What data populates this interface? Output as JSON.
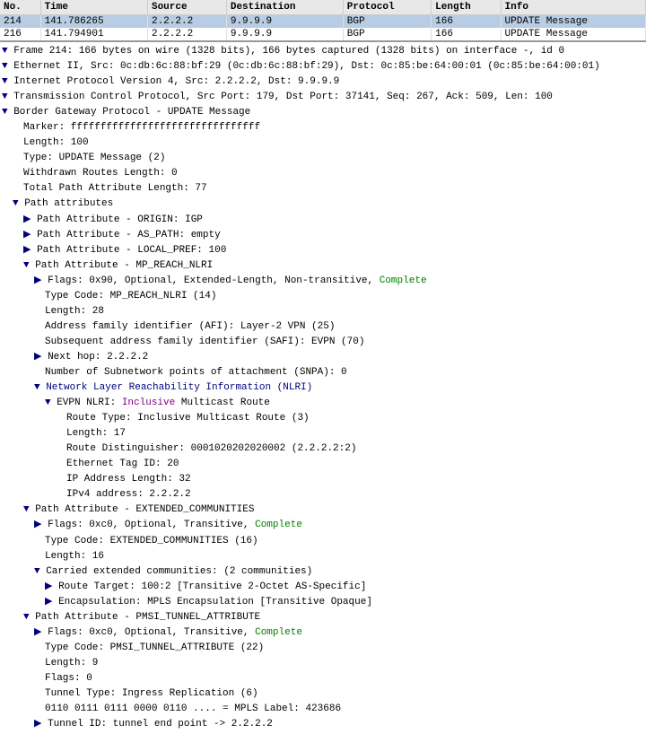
{
  "table": {
    "headers": [
      "No.",
      "Time",
      "Source",
      "Destination",
      "Protocol",
      "Length",
      "Info"
    ],
    "rows": [
      {
        "no": "214",
        "time": "141.786265",
        "source": "2.2.2.2",
        "destination": "9.9.9.9",
        "protocol": "BGP",
        "length": "166",
        "info": "UPDATE Message",
        "selected": true
      },
      {
        "no": "216",
        "time": "141.794901",
        "source": "2.2.2.2",
        "destination": "9.9.9.9",
        "protocol": "BGP",
        "length": "166",
        "info": "UPDATE Message",
        "selected": false
      }
    ]
  },
  "detail": {
    "lines": [
      {
        "indent": 0,
        "type": "arrow-down",
        "text": "Frame 214: 166 bytes on wire (1328 bits), 166 bytes captured (1328 bits) on interface -, id 0"
      },
      {
        "indent": 0,
        "type": "arrow-down",
        "text": "Ethernet II, Src: 0c:db:6c:88:bf:29 (0c:db:6c:88:bf:29), Dst: 0c:85:be:64:00:01 (0c:85:be:64:00:01)"
      },
      {
        "indent": 0,
        "type": "arrow-down",
        "text": "Internet Protocol Version 4, Src: 2.2.2.2, Dst: 9.9.9.9"
      },
      {
        "indent": 0,
        "type": "arrow-down",
        "text": "Transmission Control Protocol, Src Port: 179, Dst Port: 37141, Seq: 267, Ack: 509, Len: 100"
      },
      {
        "indent": 0,
        "type": "arrow-down",
        "text": "Border Gateway Protocol - UPDATE Message"
      },
      {
        "indent": 1,
        "type": "bullet",
        "text": "Marker: ffffffffffffffffffffffffffffffff"
      },
      {
        "indent": 1,
        "type": "bullet",
        "text": "Length: 100"
      },
      {
        "indent": 1,
        "type": "bullet",
        "text": "Type: UPDATE Message (2)"
      },
      {
        "indent": 1,
        "type": "bullet",
        "text": "Withdrawn Routes Length: 0"
      },
      {
        "indent": 1,
        "type": "bullet",
        "text": "Total Path Attribute Length: 77"
      },
      {
        "indent": 1,
        "type": "arrow-down",
        "text": "Path attributes"
      },
      {
        "indent": 2,
        "type": "arrow-right",
        "text": "Path Attribute - ORIGIN: IGP"
      },
      {
        "indent": 2,
        "type": "arrow-right",
        "text": "Path Attribute - AS_PATH: empty"
      },
      {
        "indent": 2,
        "type": "arrow-right",
        "text": "Path Attribute - LOCAL_PREF: 100"
      },
      {
        "indent": 2,
        "type": "arrow-down",
        "text": "Path Attribute - MP_REACH_NLRI"
      },
      {
        "indent": 3,
        "type": "arrow-right",
        "text": "Flags: 0x90, Optional, Extended-Length, Non-transitive, Complete",
        "highlight": "complete"
      },
      {
        "indent": 3,
        "type": "bullet",
        "text": "Type Code: MP_REACH_NLRI (14)"
      },
      {
        "indent": 3,
        "type": "bullet",
        "text": "Length: 28"
      },
      {
        "indent": 3,
        "type": "bullet",
        "text": "Address family identifier (AFI): Layer-2 VPN (25)"
      },
      {
        "indent": 3,
        "type": "bullet",
        "text": "Subsequent address family identifier (SAFI): EVPN (70)"
      },
      {
        "indent": 3,
        "type": "arrow-right",
        "text": "Next hop: 2.2.2.2"
      },
      {
        "indent": 3,
        "type": "bullet",
        "text": "Number of Subnetwork points of attachment (SNPA): 0"
      },
      {
        "indent": 3,
        "type": "arrow-down",
        "text": "Network Layer Reachability Information (NLRI)",
        "highlight": "network"
      },
      {
        "indent": 4,
        "type": "arrow-down",
        "text": "EVPN NLRI: Inclusive Multicast Route",
        "highlight": "inclusive"
      },
      {
        "indent": 5,
        "type": "bullet",
        "text": "Route Type: Inclusive Multicast Route (3)"
      },
      {
        "indent": 5,
        "type": "bullet",
        "text": "Length: 17"
      },
      {
        "indent": 5,
        "type": "bullet",
        "text": "Route Distinguisher: 0001020202020002 (2.2.2.2:2)"
      },
      {
        "indent": 5,
        "type": "bullet",
        "text": "Ethernet Tag ID: 20"
      },
      {
        "indent": 5,
        "type": "bullet",
        "text": "IP Address Length: 32"
      },
      {
        "indent": 5,
        "type": "bullet",
        "text": "IPv4 address: 2.2.2.2"
      },
      {
        "indent": 2,
        "type": "arrow-down",
        "text": "Path Attribute - EXTENDED_COMMUNITIES"
      },
      {
        "indent": 3,
        "type": "arrow-right",
        "text": "Flags: 0xc0, Optional, Transitive, Complete",
        "highlight": "complete"
      },
      {
        "indent": 3,
        "type": "bullet",
        "text": "Type Code: EXTENDED_COMMUNITIES (16)"
      },
      {
        "indent": 3,
        "type": "bullet",
        "text": "Length: 16"
      },
      {
        "indent": 3,
        "type": "arrow-down",
        "text": "Carried extended communities: (2 communities)"
      },
      {
        "indent": 4,
        "type": "arrow-right",
        "text": "Route Target: 100:2 [Transitive 2-Octet AS-Specific]"
      },
      {
        "indent": 4,
        "type": "arrow-right",
        "text": "Encapsulation: MPLS Encapsulation [Transitive Opaque]"
      },
      {
        "indent": 2,
        "type": "arrow-down",
        "text": "Path Attribute - PMSI_TUNNEL_ATTRIBUTE"
      },
      {
        "indent": 3,
        "type": "arrow-right",
        "text": "Flags: 0xc0, Optional, Transitive, Complete",
        "highlight": "complete"
      },
      {
        "indent": 3,
        "type": "bullet",
        "text": "Type Code: PMSI_TUNNEL_ATTRIBUTE (22)"
      },
      {
        "indent": 3,
        "type": "bullet",
        "text": "Length: 9"
      },
      {
        "indent": 3,
        "type": "bullet",
        "text": "Flags: 0"
      },
      {
        "indent": 3,
        "type": "bullet",
        "text": "Tunnel Type: Ingress Replication (6)"
      },
      {
        "indent": 3,
        "type": "bullet",
        "text": "0110 0111 0111 0000 0110 .... = MPLS Label: 423686"
      },
      {
        "indent": 3,
        "type": "arrow-right",
        "text": "Tunnel ID: tunnel end point -> 2.2.2.2"
      }
    ]
  }
}
